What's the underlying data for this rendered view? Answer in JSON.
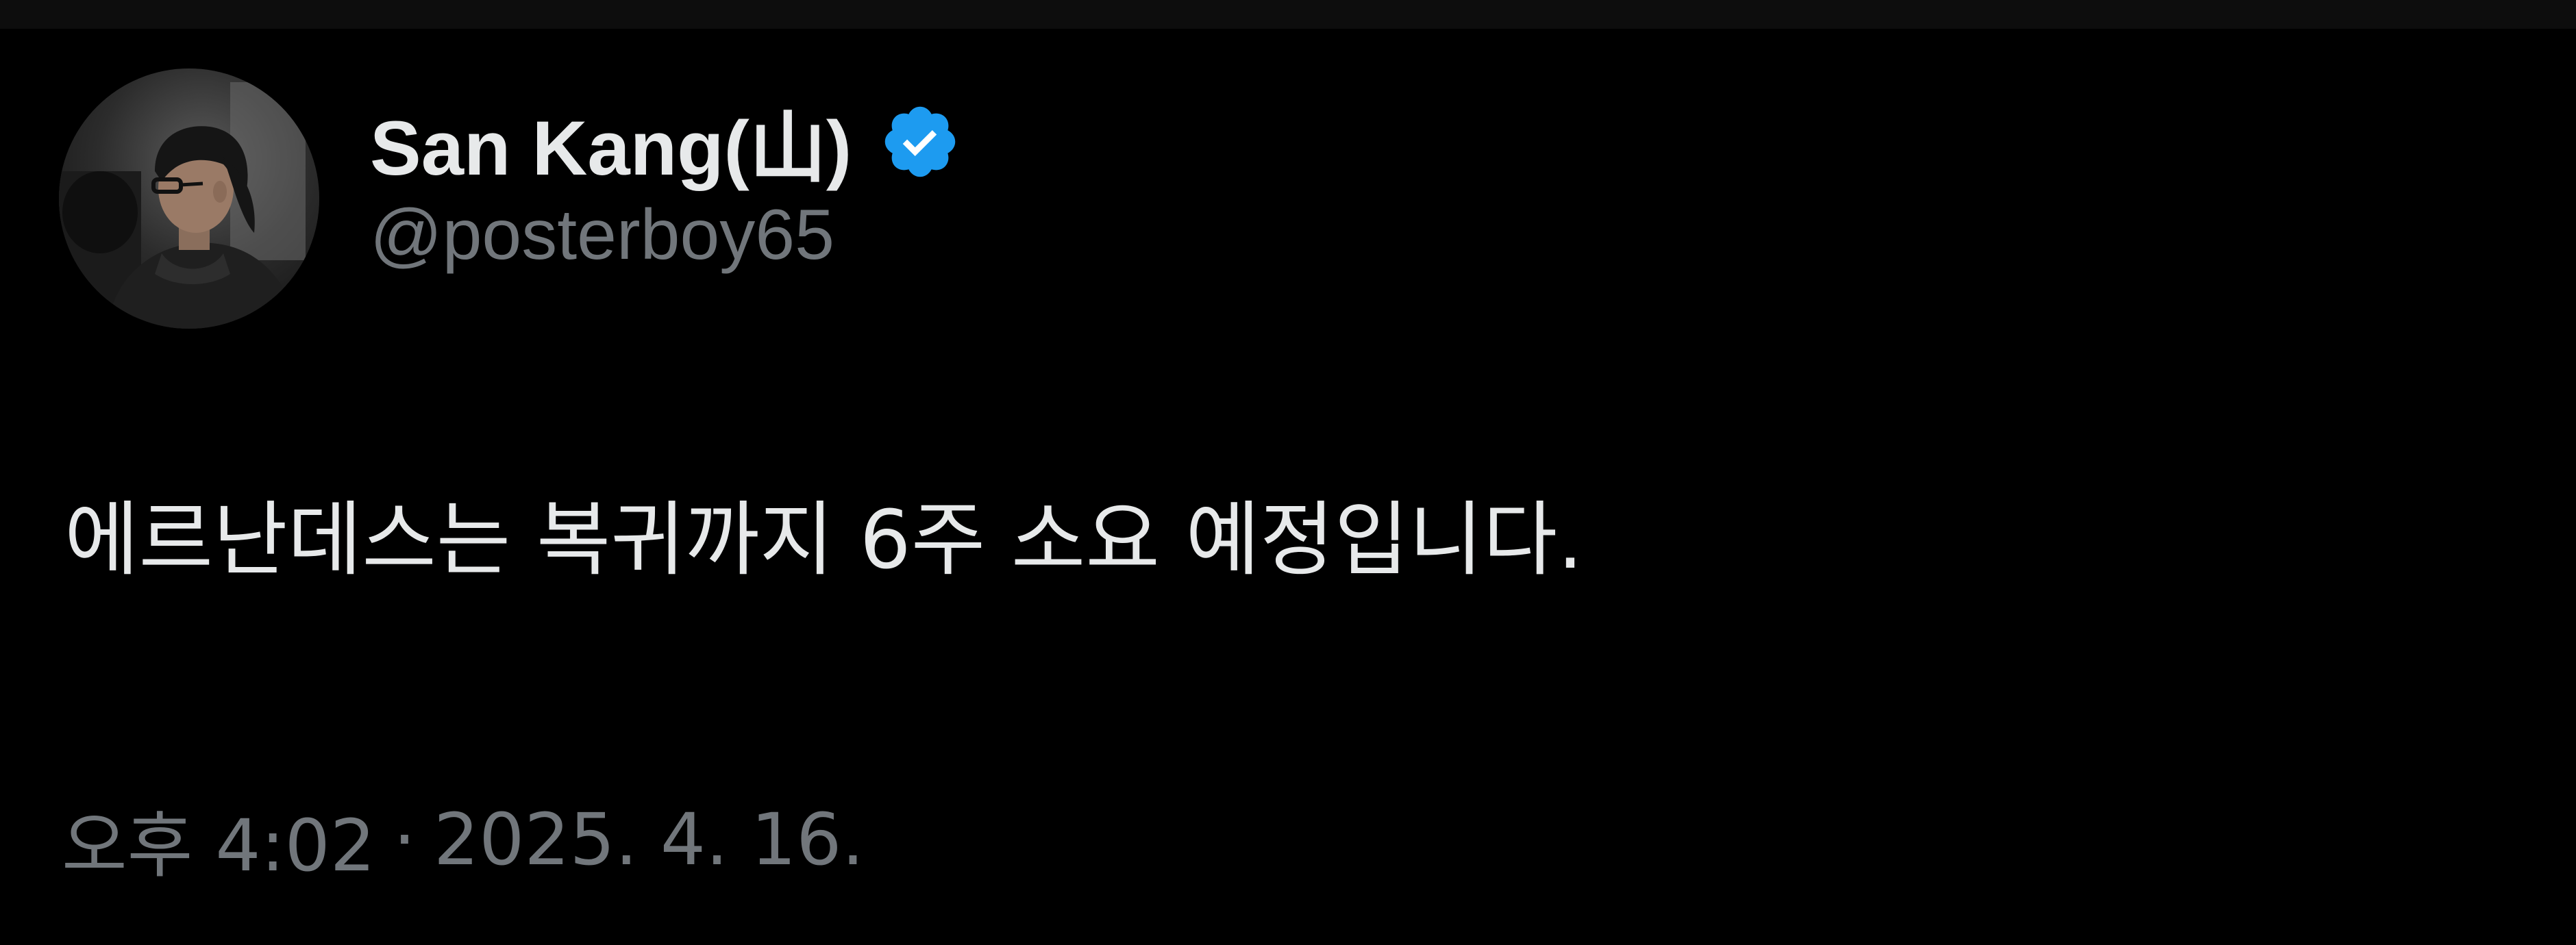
{
  "post": {
    "author": {
      "display_name": "San Kang(山)",
      "handle": "@posterboy65",
      "verified_icon": "verified-badge-icon",
      "verified_color": "#1d9bf0"
    },
    "text": "에르난데스는 복귀까지 6주 소요 예정입니다.",
    "time": "오후 4:02",
    "separator": "·",
    "date": "2025. 4. 16."
  },
  "colors": {
    "background": "#000000",
    "primary_text": "#e7e9ea",
    "secondary_text": "#71767b"
  }
}
